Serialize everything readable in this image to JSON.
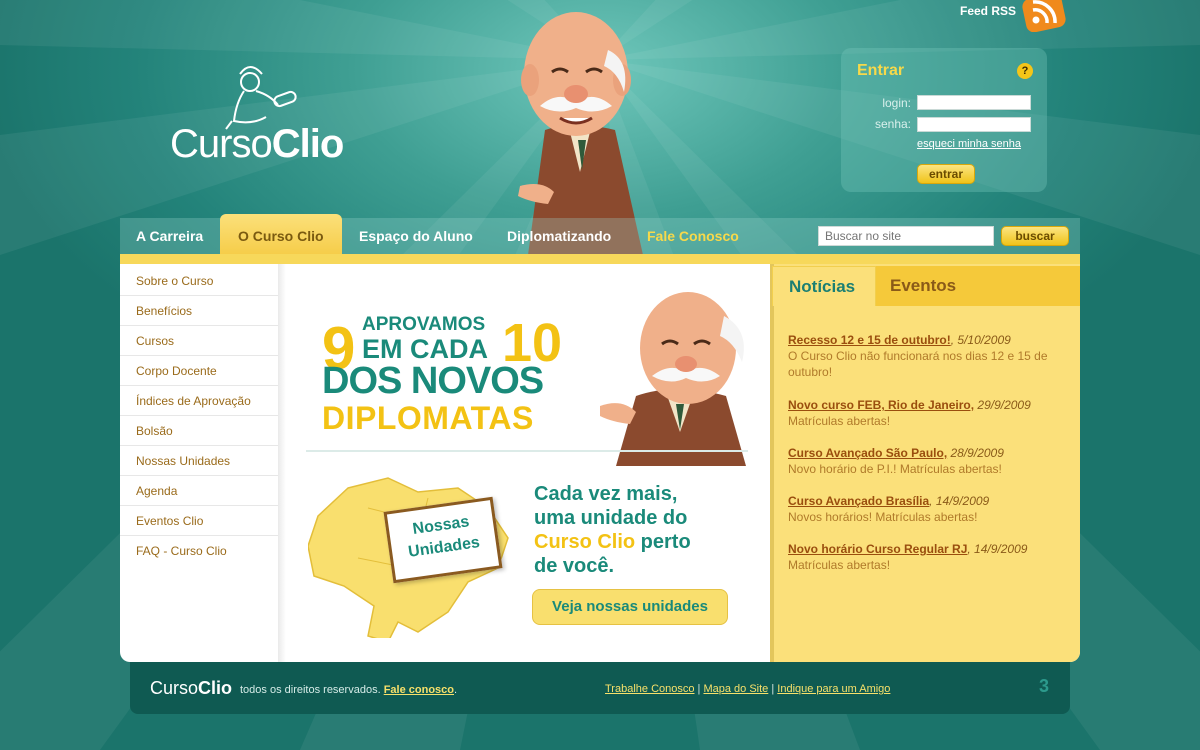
{
  "colors": {
    "teal": "#1a8a7a",
    "yellow": "#f3c214",
    "brown": "#9a4e0e",
    "bg": "#23837a"
  },
  "topbar": {
    "feed_label": "Feed RSS",
    "feed_icon": "rss-icon"
  },
  "logo": {
    "light": "Curso",
    "bold": "Clio",
    "icon": "muse-logo-icon"
  },
  "login": {
    "title": "Entrar",
    "help_icon": "help-icon",
    "help_glyph": "?",
    "login_label": "login:",
    "password_label": "senha:",
    "login_value": "",
    "password_value": "",
    "forgot": "esqueci minha senha",
    "submit": "entrar"
  },
  "nav": {
    "items": [
      "A Carreira",
      "O Curso Clio",
      "Espaço do Aluno",
      "Diplomatizando",
      "Fale Conosco"
    ],
    "active_index": 1,
    "search_placeholder": "Buscar no site",
    "search_button": "buscar"
  },
  "sidebar": {
    "items": [
      "Sobre o Curso",
      "Benefícios",
      "Cursos",
      "Corpo Docente",
      "Índices de Aprovação",
      "Bolsão",
      "Nossas Unidades",
      "Agenda",
      "Eventos Clio",
      "FAQ - Curso Clio"
    ]
  },
  "banner": {
    "num_left": "9",
    "num_right": "10",
    "line1": "APROVAMOS",
    "line2": "EM CADA",
    "line3": "DOS NOVOS",
    "line4": "DIPLOMATAS"
  },
  "units": {
    "card_line1": "Nossas",
    "card_line2": "Unidades",
    "text_line1": "Cada vez mais,",
    "text_line2": "uma unidade do",
    "text_highlight": "Curso Clio",
    "text_after_highlight": " perto",
    "text_line4": "de você.",
    "button": "Veja nossas unidades"
  },
  "news": {
    "tab_active": "Notícias",
    "tab_inactive": "Eventos",
    "items": [
      {
        "title": "Recesso 12 e 15 de outubro!",
        "date": "5/10/2009",
        "body": "O Curso Clio não funcionará nos dias 12 e 15 de outubro!"
      },
      {
        "title": "Novo curso FEB, Rio de Janeiro,",
        "date": "29/9/2009",
        "body": "Matrículas abertas!"
      },
      {
        "title": "Curso Avançado São Paulo,",
        "date": "28/9/2009",
        "body": "Novo horário de P.I.! Matrículas abertas!"
      },
      {
        "title": "Curso Avançado Brasília",
        "date": "14/9/2009",
        "body": "Novos horários! Matrículas abertas!"
      },
      {
        "title": "Novo horário Curso Regular RJ",
        "date": "14/9/2009",
        "body": "Matrículas abertas!"
      }
    ]
  },
  "footer": {
    "logo_light": "Curso",
    "logo_bold": "Clio",
    "copy": "todos os direitos reservados.",
    "contact": "Fale conosco",
    "link1": "Trabalhe Conosco",
    "link2": "Mapa do Site",
    "link3": "Indique para um Amigo",
    "page_badge": "3"
  }
}
